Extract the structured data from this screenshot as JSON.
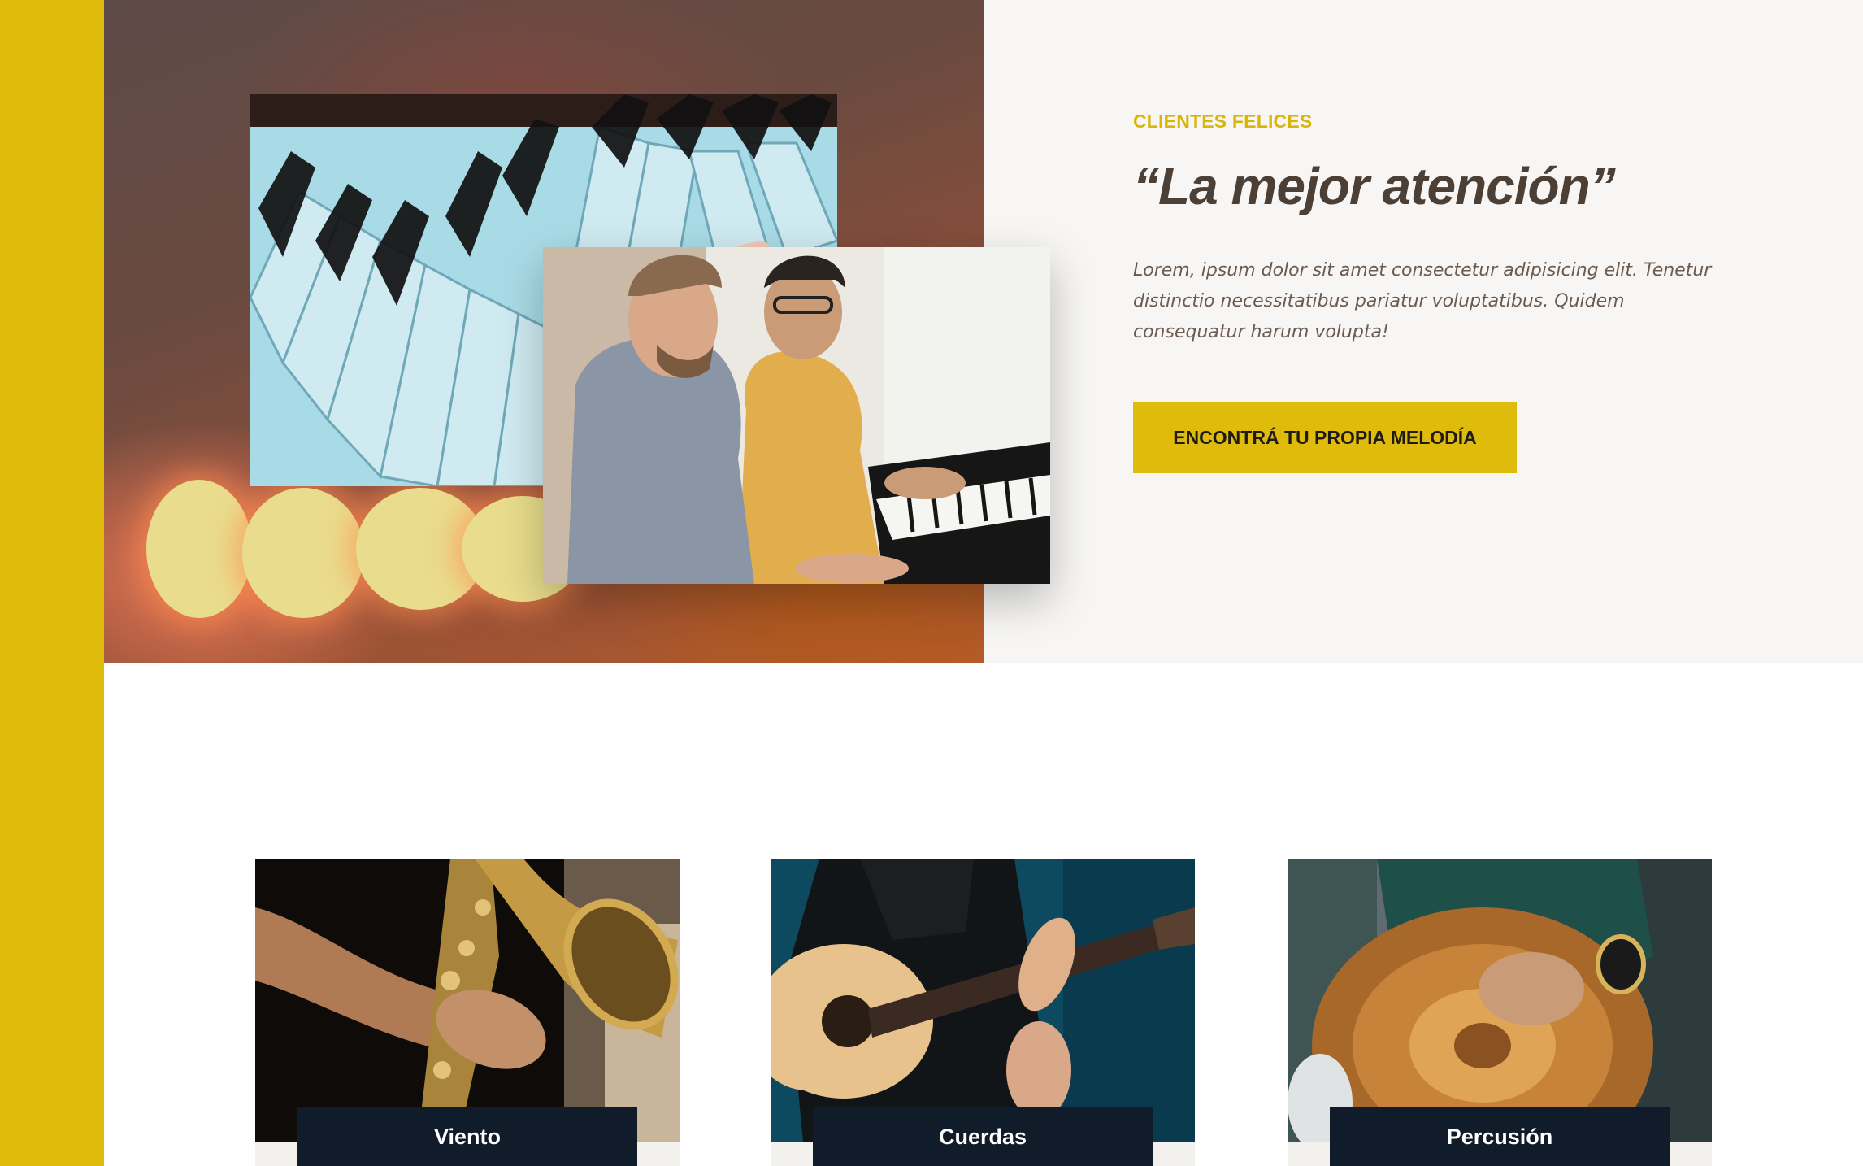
{
  "hero": {
    "eyebrow": "CLIENTES FELICES",
    "quote": "“La mejor atención”",
    "body": "Lorem, ipsum dolor sit amet consectetur adipisicing elit. Tenetur distinctio necessitatibus pariatur voluptatibus. Quidem consequatur harum volupta!",
    "cta_label": "ENCONTRÁ TU PROPIA MELODÍA"
  },
  "categories": [
    {
      "label": "Viento"
    },
    {
      "label": "Cuerdas"
    },
    {
      "label": "Percusión"
    }
  ],
  "colors": {
    "accent": "#dfbb0b",
    "quote_text": "#4c3f36",
    "card_label_bg": "#111c2a",
    "hero_right_bg": "#f7f6f4"
  }
}
